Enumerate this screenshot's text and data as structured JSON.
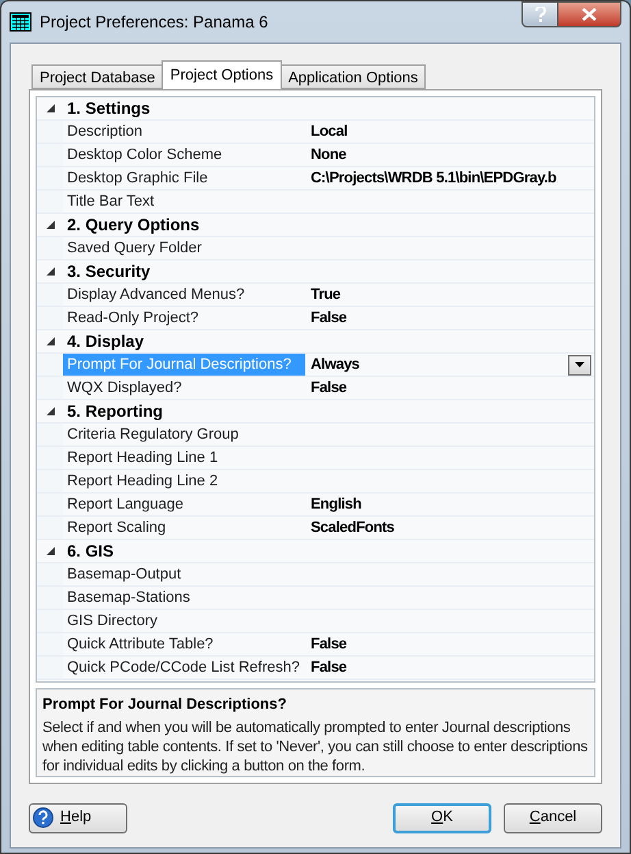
{
  "window": {
    "title": "Project Preferences: Panama 6"
  },
  "tabs": [
    {
      "label": "Project Database",
      "selected": false
    },
    {
      "label": "Project Options",
      "selected": true
    },
    {
      "label": "Application Options",
      "selected": false
    }
  ],
  "sections": [
    {
      "title": "1. Settings",
      "expanded": true,
      "properties": [
        {
          "label": "Description",
          "value": "Local",
          "selected": false,
          "kind": "text"
        },
        {
          "label": "Desktop Color Scheme",
          "value": "None",
          "selected": false,
          "kind": "text"
        },
        {
          "label": "Desktop Graphic File",
          "value": "C:\\Projects\\WRDB 5.1\\bin\\EPDGray.b",
          "selected": false,
          "kind": "text"
        },
        {
          "label": "Title Bar Text",
          "selected": false,
          "kind": "text"
        }
      ]
    },
    {
      "title": "2. Query Options",
      "expanded": true,
      "properties": [
        {
          "label": "Saved Query Folder",
          "selected": false,
          "kind": "text"
        }
      ]
    },
    {
      "title": "3. Security",
      "expanded": true,
      "properties": [
        {
          "label": "Display Advanced Menus?",
          "value": "True",
          "selected": false,
          "kind": "text"
        },
        {
          "label": "Read-Only Project?",
          "value": "False",
          "selected": false,
          "kind": "text"
        }
      ]
    },
    {
      "title": "4. Display",
      "expanded": true,
      "properties": [
        {
          "label": "Prompt For Journal Descriptions?",
          "value": "Always",
          "selected": true,
          "kind": "dropdown"
        },
        {
          "label": "WQX Displayed?",
          "value": "False",
          "selected": false,
          "kind": "text"
        }
      ]
    },
    {
      "title": "5. Reporting",
      "expanded": true,
      "properties": [
        {
          "label": "Criteria Regulatory Group",
          "selected": false,
          "kind": "text"
        },
        {
          "label": "Report Heading Line 1",
          "selected": false,
          "kind": "text"
        },
        {
          "label": "Report Heading Line 2",
          "selected": false,
          "kind": "text"
        },
        {
          "label": "Report Language",
          "value": "English",
          "selected": false,
          "kind": "text"
        },
        {
          "label": "Report Scaling",
          "value": "ScaledFonts",
          "selected": false,
          "kind": "text"
        }
      ]
    },
    {
      "title": "6. GIS",
      "expanded": true,
      "properties": [
        {
          "label": "Basemap-Output",
          "selected": false,
          "kind": "text"
        },
        {
          "label": "Basemap-Stations",
          "selected": false,
          "kind": "text"
        },
        {
          "label": "GIS Directory",
          "selected": false,
          "kind": "text"
        },
        {
          "label": "Quick Attribute Table?",
          "value": "False",
          "selected": false,
          "kind": "text"
        },
        {
          "label": "Quick PCode/CCode List Refresh?",
          "value": "False",
          "selected": false,
          "kind": "text"
        }
      ]
    }
  ],
  "description": {
    "title": "Prompt For Journal Descriptions?",
    "text": "Select if and when you will be automatically prompted to enter Journal descriptions when editing table contents. If set to 'Never', you can still choose to enter descriptions for individual edits by clicking a button on the form."
  },
  "buttons": [
    {
      "label": "Help",
      "kind": "help",
      "default": false
    },
    {
      "label": "OK",
      "kind": "plain",
      "default": true
    },
    {
      "label": "Cancel",
      "kind": "plain",
      "default": false
    }
  ]
}
